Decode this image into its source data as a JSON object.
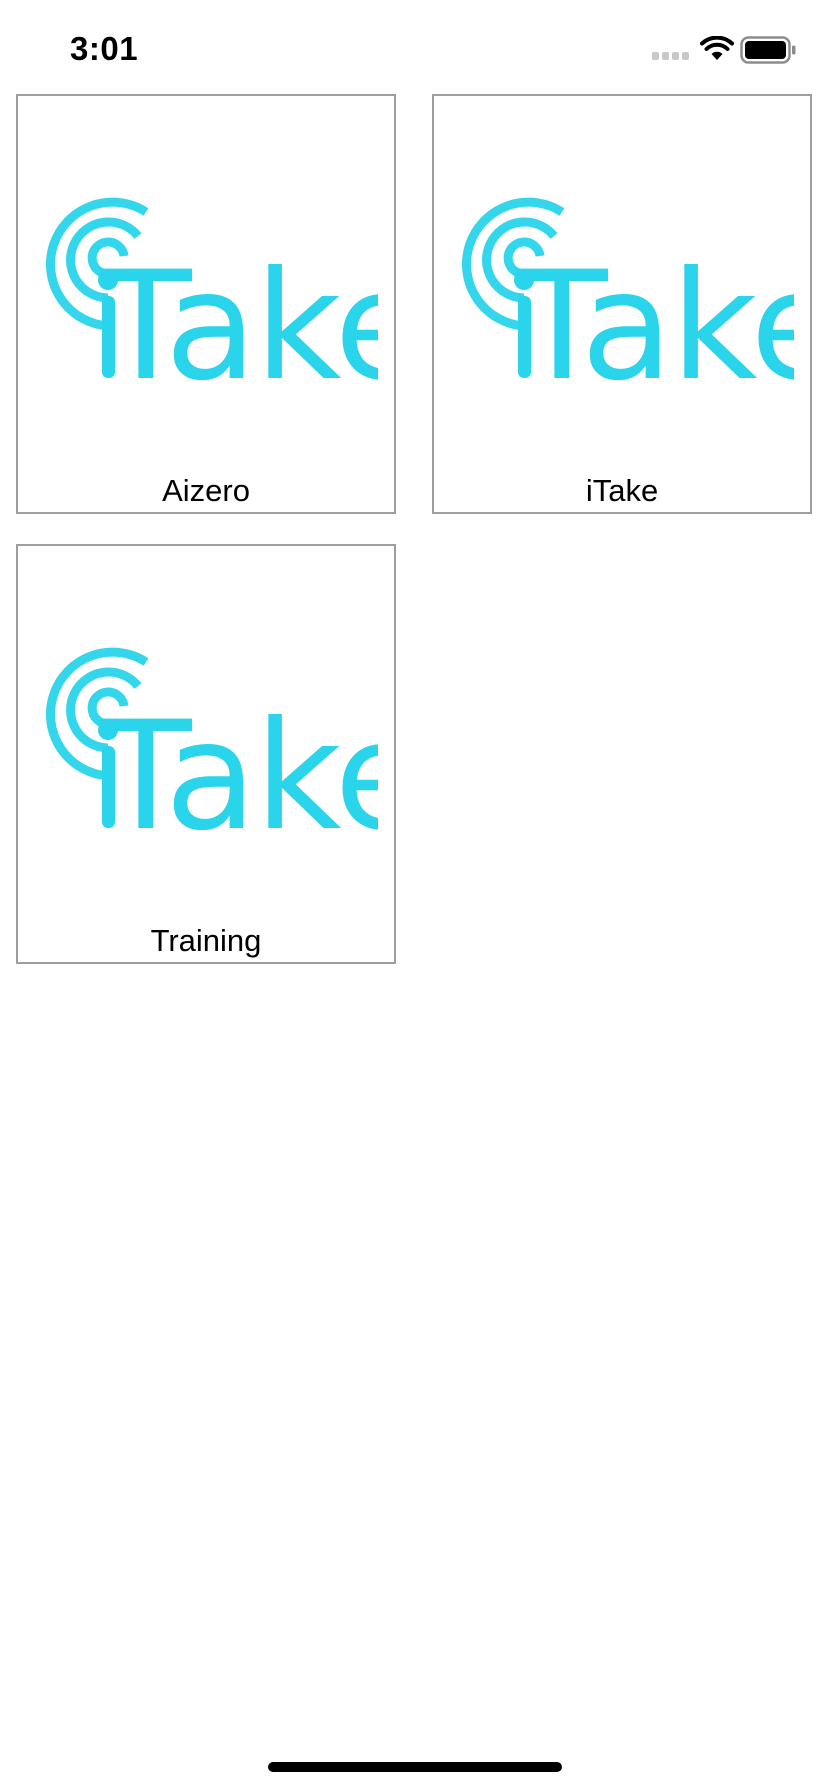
{
  "status_bar": {
    "time": "3:01",
    "signal_icon": "cellular-signal-icon",
    "wifi_icon": "wifi-icon",
    "battery_icon": "battery-icon"
  },
  "logo": {
    "text": "iTake",
    "color": "#2ad4ea",
    "icon": "broadcast-target-icon"
  },
  "cards": [
    {
      "label": "Aizero"
    },
    {
      "label": "iTake"
    },
    {
      "label": "Training"
    }
  ],
  "colors": {
    "card_border": "#9e9e9e",
    "logo_accent": "#2ad4ea"
  }
}
